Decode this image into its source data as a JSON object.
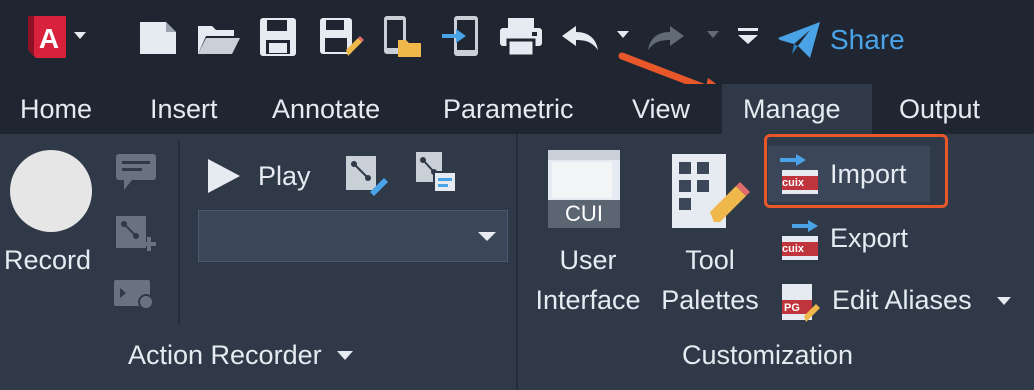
{
  "app": {
    "logo_letter": "A",
    "share_label": "Share"
  },
  "quick_access": {
    "items": [
      "new-icon",
      "open-icon",
      "save-icon",
      "save-as-icon",
      "open-from-web-icon",
      "save-to-web-icon",
      "plot-icon",
      "undo-icon",
      "redo-icon",
      "customize-icon"
    ]
  },
  "tabs": [
    "Home",
    "Insert",
    "Annotate",
    "Parametric",
    "View",
    "Manage",
    "Output"
  ],
  "active_tab": "Manage",
  "action_recorder": {
    "record_label": "Record",
    "play_label": "Play",
    "dropdown_value": "",
    "panel_title": "Action Recorder"
  },
  "customization": {
    "cui_badge": "CUI",
    "user_interface_label": [
      "User",
      "Interface"
    ],
    "tool_palettes_label": [
      "Tool",
      "Palettes"
    ],
    "import_label": "Import",
    "export_label": "Export",
    "edit_aliases_label": "Edit Aliases",
    "cuix_badge": "cuix",
    "pgp_badge": "PG",
    "panel_title": "Customization"
  },
  "colors": {
    "brand_red": "#d8223c",
    "share_blue": "#4aa3e6",
    "highlight_orange": "#e8572a",
    "ribbon_bg": "#2f3948",
    "titlebar_bg": "#1f2632"
  }
}
